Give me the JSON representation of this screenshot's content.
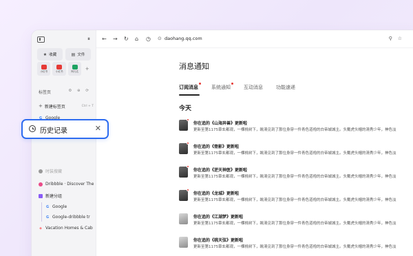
{
  "sidebar": {
    "quick": [
      {
        "icon": "star-icon",
        "label": "收藏"
      },
      {
        "icon": "file-icon",
        "label": "文件"
      }
    ],
    "apps": [
      {
        "label": "小红书",
        "color": "#e53935"
      },
      {
        "label": "小红书",
        "color": "#e53935"
      },
      {
        "label": "阿凡达",
        "color": "#1ea362"
      }
    ],
    "tabs_title": "标签页",
    "new_tab": "新建标签页",
    "new_tab_shortcut": "Ctrl + T",
    "items": [
      {
        "label": "Google"
      },
      {
        "label": "时装搜藏"
      },
      {
        "label": "Dribbble · Discover The"
      },
      {
        "label": "新建分组"
      },
      {
        "label": "Google"
      },
      {
        "label": "Google-dribbble tr"
      },
      {
        "label": "Vacation Homes & Cab"
      }
    ]
  },
  "toolbar": {
    "url": "daohang.qq.com"
  },
  "content": {
    "page_title": "消息通知",
    "tabs": [
      {
        "label": "订阅消息",
        "active": true,
        "dot": true
      },
      {
        "label": "系统通知",
        "active": false,
        "dot": true
      },
      {
        "label": "互动消息",
        "active": false,
        "dot": false
      },
      {
        "label": "功能速递",
        "active": false,
        "dot": false
      }
    ],
    "day": "今天",
    "notifications": [
      {
        "title": "你在追的《山海异兽》更新啦",
        "body": "更新至第1175章玄都观，一棵桃树下，眺清见到了那位身穿一件青色道袍的白帝城城主。头戴虎头帽的清秀少年，神色淡"
      },
      {
        "title": "你在追的《斋影》更新啦",
        "body": "更新至第1175章玄都观，一棵桃树下，眺清见到了那位身穿一件青色道袍的白帝城城主。头戴虎头帽的清秀少年，神色淡"
      },
      {
        "title": "你在追的《逆天神医》更新啦",
        "body": "更新至第1175章玄都观，一棵桃树下，眺清见到了那位身穿一件青色道袍的白帝城城主。头戴虎头帽的清秀少年，神色淡"
      },
      {
        "title": "你在追的《龙城》更新啦",
        "body": "更新至第1175章玄都观，一棵桃树下，眺清见到了那位身穿一件青色道袍的白帝城城主。头戴虎头帽的清秀少年，神色淡"
      },
      {
        "title": "你在追的《江湖梦》更新啦",
        "body": "更新至第1175章玄都观，一棵桃树下，眺清见到了那位身穿一件青色道袍的白帝城城主。头戴虎头帽的清秀少年，神色淡"
      },
      {
        "title": "你在追的《桃天弦》更新啦",
        "body": "更新至第1175章玄都观，一棵桃树下，眺清见到了那位身穿一件青色道袍的白帝城城主。头戴虎头帽的清秀少年，神色淡"
      }
    ]
  },
  "history_popup": {
    "label": "历史记录"
  }
}
